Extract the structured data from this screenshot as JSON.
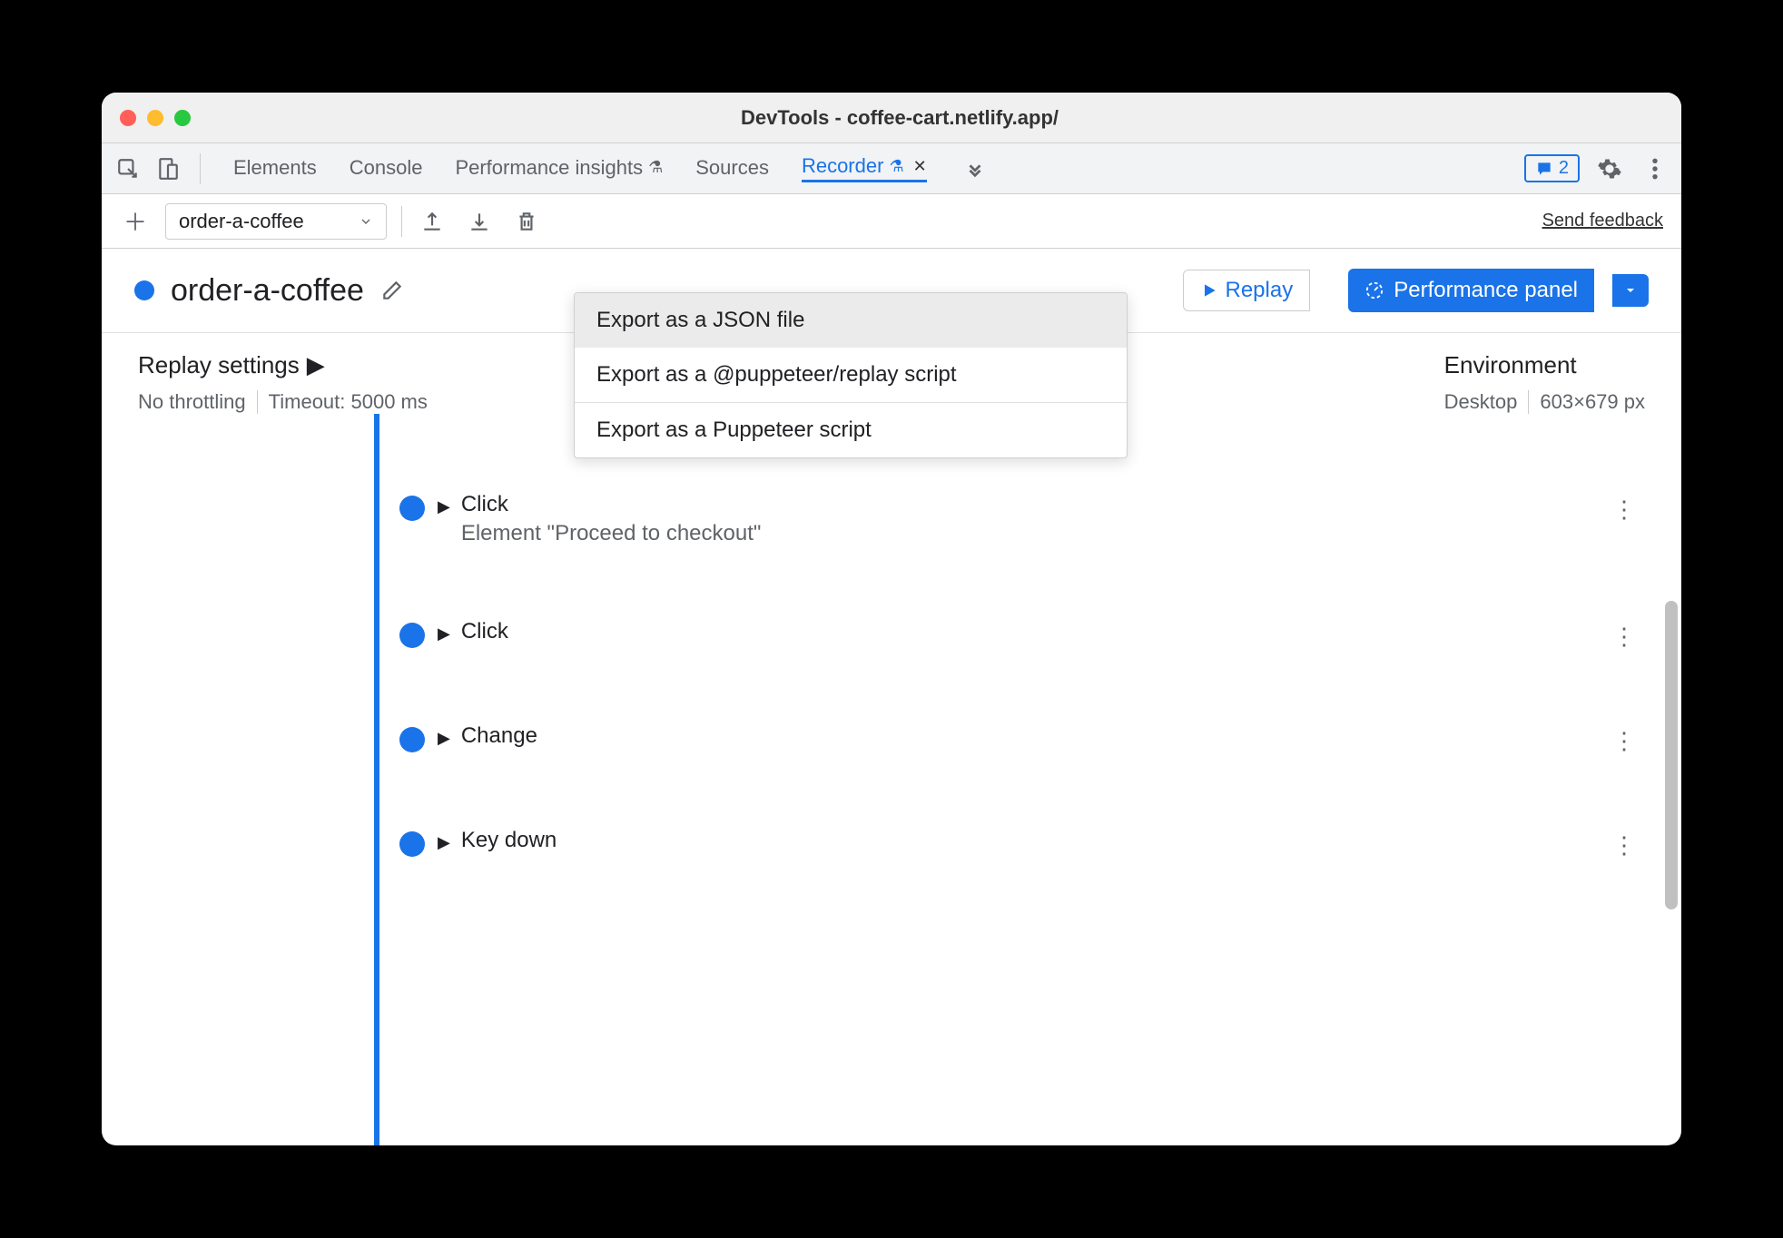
{
  "title": "DevTools - coffee-cart.netlify.app/",
  "tabs": {
    "elements": "Elements",
    "console": "Console",
    "perf_insights": "Performance insights",
    "sources": "Sources",
    "recorder": "Recorder"
  },
  "badge_count": "2",
  "toolbar": {
    "recording_name": "order-a-coffee",
    "feedback": "Send feedback"
  },
  "header": {
    "title": "order-a-coffee",
    "replay": "Replay",
    "perf_panel": "Performance panel"
  },
  "settings": {
    "title": "Replay settings",
    "throttle": "No throttling",
    "timeout": "Timeout: 5000 ms",
    "env_title": "Environment",
    "device": "Desktop",
    "viewport": "603×679 px"
  },
  "export_menu": {
    "json": "Export as a JSON file",
    "puppeteer_replay": "Export as a @puppeteer/replay script",
    "puppeteer": "Export as a Puppeteer script"
  },
  "steps": [
    {
      "label": "Click",
      "sub": "Element \"Proceed to checkout\""
    },
    {
      "label": "Click",
      "sub": ""
    },
    {
      "label": "Change",
      "sub": ""
    },
    {
      "label": "Key down",
      "sub": ""
    }
  ]
}
